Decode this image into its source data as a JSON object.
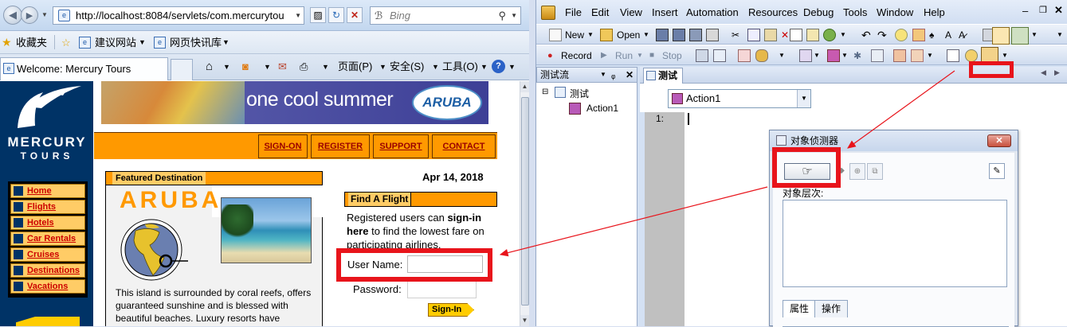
{
  "browser": {
    "address": "http://localhost:8084/servlets/com.mercurytou",
    "search_placeholder": "Bing",
    "favorites": {
      "label": "收藏夹",
      "suggested": "建议网站",
      "feeds": "网页快讯库"
    },
    "tab_title": "Welcome: Mercury Tours",
    "commands": {
      "page": "页面(P)",
      "safety": "安全(S)",
      "tools": "工具(O)"
    }
  },
  "site": {
    "logo_line1": "MERCURY",
    "logo_line2": "TOURS",
    "banner_text": "one cool summer",
    "banner_logo": "ARUBA",
    "top_links": [
      "SIGN-ON",
      "REGISTER",
      "SUPPORT",
      "CONTACT"
    ],
    "nav": [
      "Home",
      "Flights",
      "Hotels",
      "Car Rentals",
      "Cruises",
      "Destinations",
      "Vacations"
    ],
    "featured_title": "Featured Destination",
    "featured_name": "ARUBA",
    "featured_text": "This island is surrounded by coral reefs, offers guaranteed sunshine and is blessed with beautiful beaches. Luxury resorts have",
    "date": "Apr 14, 2018",
    "find_flight_title": "Find A Flight",
    "registered_text_plain1": "Registered users can ",
    "registered_text_bold": "sign-in here",
    "registered_text_plain2": " to find the lowest fare on participating airlines.",
    "user_label": "User Name:",
    "pass_label": "Password:",
    "signin_label": "Sign-In",
    "user_value": "",
    "pass_value": ""
  },
  "qtp": {
    "menu": [
      "File",
      "Edit",
      "View",
      "Insert",
      "Automation",
      "Resources",
      "Debug",
      "Tools",
      "Window",
      "Help"
    ],
    "toolbar1": {
      "new": "New",
      "open": "Open"
    },
    "toolbar2": {
      "record": "Record",
      "run": "Run",
      "stop": "Stop"
    },
    "testflow_title": "测试流",
    "tree_root": "测试",
    "tree_child": "Action1",
    "doc_tab": "测试",
    "action_combo": "Action1",
    "line_number": "1:",
    "spy": {
      "title": "对象侦测器",
      "hierarchy_label": "对象层次:",
      "tab_properties": "属性",
      "tab_operations": "操作"
    }
  },
  "colors": {
    "highlight": "#e8141b",
    "mt_navy": "#003366",
    "mt_orange": "#ff9900"
  }
}
